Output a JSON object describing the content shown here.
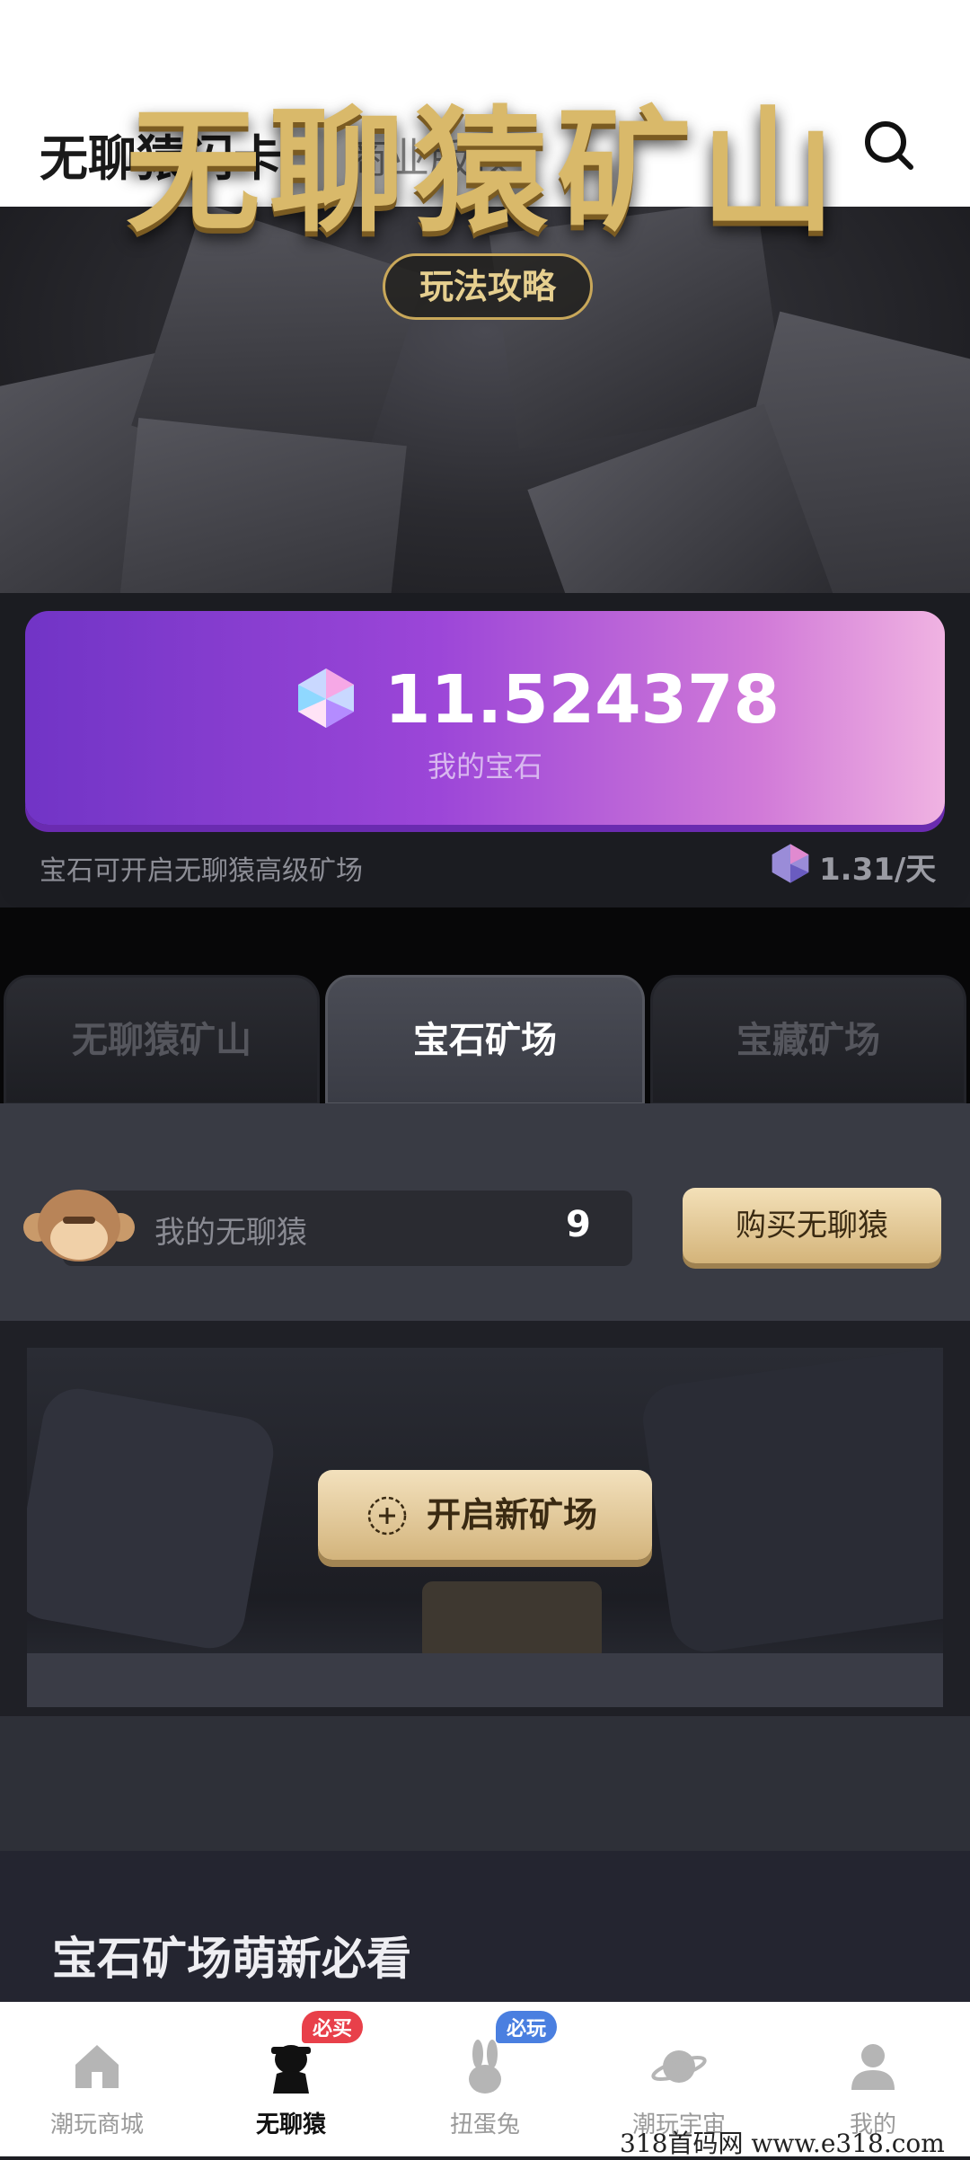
{
  "header": {
    "title": "无聊猿闪卡",
    "tab": "商业版权"
  },
  "banner": {
    "title": "无聊猿矿山",
    "guide_button": "玩法攻略"
  },
  "gem": {
    "value": "11.524378",
    "label": "我的宝石",
    "description": "宝石可开启无聊猿高级矿场",
    "rate": "1.31/天"
  },
  "tabs": [
    {
      "label": "无聊猿矿山"
    },
    {
      "label": "宝石矿场"
    },
    {
      "label": "宝藏矿场"
    }
  ],
  "monkey": {
    "label": "我的无聊猿",
    "count": "9",
    "buy_button": "购买无聊猿"
  },
  "mine": {
    "open_button": "开启新矿场"
  },
  "guide_section": {
    "title": "宝石矿场萌新必看"
  },
  "nav": [
    {
      "label": "潮玩商城"
    },
    {
      "label": "无聊猿",
      "badge": "必买"
    },
    {
      "label": "扭蛋兔",
      "badge": "必玩"
    },
    {
      "label": "潮玩宇宙"
    },
    {
      "label": "我的"
    }
  ],
  "watermark": "318首码网 www.e318.com",
  "colors": {
    "gem_card": "#9c46d8",
    "gold": "#d4b47a",
    "badge_red": "#e8404a",
    "badge_blue": "#4a7fe0"
  }
}
